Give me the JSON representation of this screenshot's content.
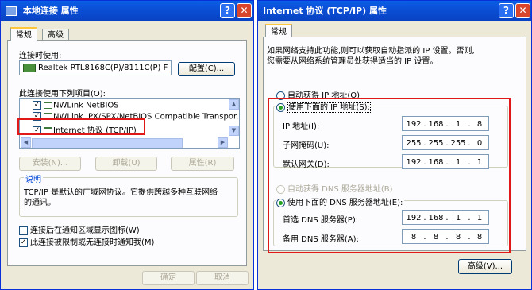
{
  "left": {
    "title": "本地连接 属性",
    "tabs": [
      "常规",
      "高级"
    ],
    "connect_using_label": "连接时使用:",
    "adapter_name": "Realtek RTL8168C(P)/8111C(P) F",
    "configure_button": "配置(C)...",
    "items_label": "此连接使用下列项目(O):",
    "items": [
      "NWLink NetBIOS",
      "NWLink IPX/SPX/NetBIOS Compatible Transpor...",
      "Internet 协议 (TCP/IP)"
    ],
    "install_button": "安装(N)...",
    "uninstall_button": "卸载(U)",
    "properties_button": "属性(R)",
    "description_label": "说明",
    "description_text_1": "TCP/IP 是默认的广域网协议。它提供跨越多种互联网络",
    "description_text_2": "的通讯。",
    "show_icon_label": "连接后在通知区域显示图标(W)",
    "notify_label": "此连接被限制或无连接时通知我(M)",
    "ok_button": "确定",
    "cancel_button": "取消"
  },
  "right": {
    "title": "Internet 协议 (TCP/IP) 属性",
    "tabs": [
      "常规"
    ],
    "info_text_1": "如果网络支持此功能,则可以获取自动指派的 IP 设置。否则,",
    "info_text_2": "您需要从网络系统管理员处获得适当的 IP 设置。",
    "auto_ip_label": "自动获得 IP 地址(O)",
    "use_ip_label": "使用下面的 IP 地址(S):",
    "ip_label": "IP 地址(I):",
    "mask_label": "子网掩码(U):",
    "gateway_label": "默认网关(D):",
    "ip": [
      "192",
      "168",
      "1",
      "8"
    ],
    "mask": [
      "255",
      "255",
      "255",
      "0"
    ],
    "gateway": [
      "192",
      "168",
      "1",
      "1"
    ],
    "auto_dns_label": "自动获得 DNS 服务器地址(B)",
    "use_dns_label": "使用下面的 DNS 服务器地址(E):",
    "pref_dns_label": "首选 DNS 服务器(P):",
    "alt_dns_label": "备用 DNS 服务器(A):",
    "pref_dns": [
      "192",
      "168",
      "1",
      "1"
    ],
    "alt_dns": [
      "8",
      "8",
      "8",
      "8"
    ],
    "advanced_button": "高级(V)..."
  },
  "colors": {
    "highlight_red": "#e01818",
    "title_blue": "#0a5fe6"
  }
}
